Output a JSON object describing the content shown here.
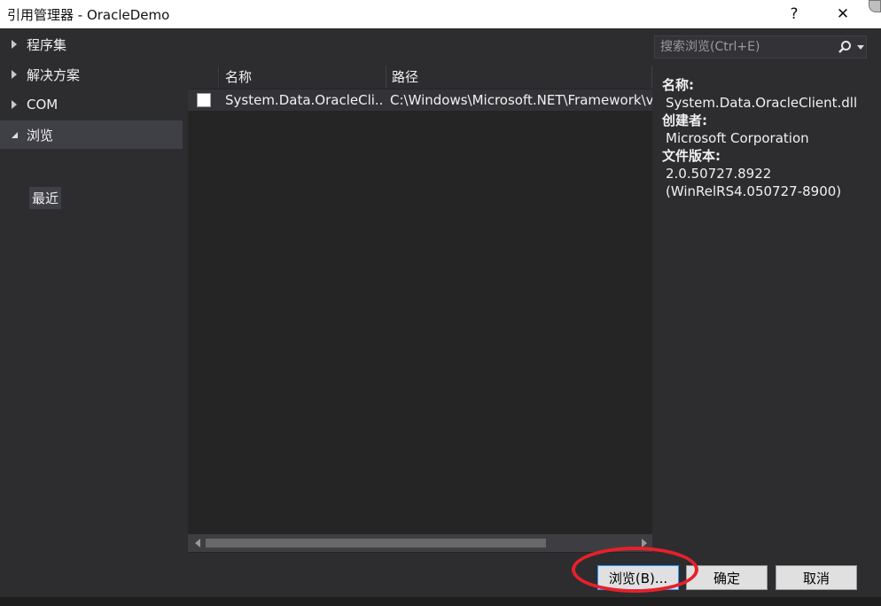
{
  "window": {
    "title": "引用管理器 - OracleDemo",
    "help_glyph": "?",
    "close_glyph": "✕"
  },
  "nav": {
    "items": [
      {
        "label": "程序集",
        "expanded": false
      },
      {
        "label": "解决方案",
        "expanded": false
      },
      {
        "label": "COM",
        "expanded": false
      },
      {
        "label": "浏览",
        "expanded": true,
        "selected": true
      }
    ],
    "sub_item": "最近"
  },
  "list": {
    "columns": [
      "名称",
      "路径"
    ],
    "rows": [
      {
        "checked": false,
        "name": "System.Data.OracleCli...",
        "path": "C:\\Windows\\Microsoft.NET\\Framework\\v"
      }
    ]
  },
  "search": {
    "placeholder": "搜索浏览(Ctrl+E)"
  },
  "details": {
    "name_label": "名称:",
    "name_value": "System.Data.OracleClient.dll",
    "creator_label": "创建者:",
    "creator_value": "Microsoft Corporation",
    "version_label": "文件版本:",
    "version_value": "2.0.50727.8922",
    "version_build": "(WinRelRS4.050727-8900)"
  },
  "footer": {
    "browse_label": "浏览(B)...",
    "ok_label": "确定",
    "cancel_label": "取消"
  },
  "colors": {
    "background": "#2d2d30",
    "list_bg": "#252526",
    "highlight": "#e8202a"
  }
}
